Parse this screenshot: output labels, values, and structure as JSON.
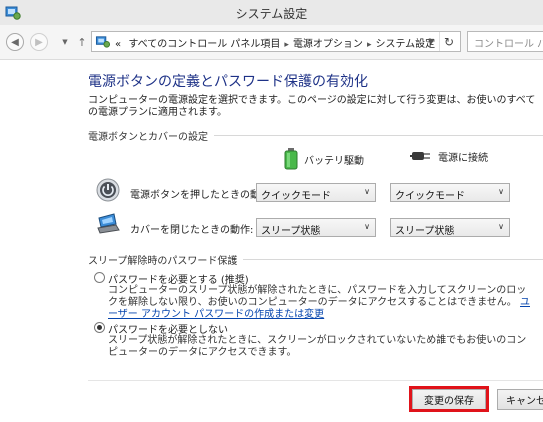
{
  "window": {
    "title": "システム設定"
  },
  "nav": {
    "breadcrumb": [
      "すべてのコントロール パネル項目",
      "電源オプション",
      "システム設定"
    ],
    "breadcrumb_prefix": "«",
    "search_placeholder": "コントロール パネル"
  },
  "content": {
    "title": "電源ボタンの定義とパスワード保護の有効化",
    "description": "コンピューターの電源設定を選択できます。このページの設定に対して行う変更は、お使いのすべての電源プランに適用されます。",
    "power_section": {
      "heading": "電源ボタンとカバーの設定",
      "columns": [
        "バッテリ駆動",
        "電源に接続"
      ],
      "rows": [
        {
          "label": "電源ボタンを押したときの動作:",
          "battery": "クイックモード",
          "plugged": "クイックモード"
        },
        {
          "label": "カバーを閉じたときの動作:",
          "battery": "スリープ状態",
          "plugged": "スリープ状態"
        }
      ]
    },
    "password_section": {
      "heading": "スリープ解除時のパスワード保護",
      "options": [
        {
          "label": "パスワードを必要とする (推奨)",
          "description": "コンピューターのスリープ状態が解除されたときに、パスワードを入力してスクリーンのロックを解除しない限り、お使いのコンピューターのデータにアクセスすることはできません。",
          "link": "ユーザー アカウント パスワードの作成または変更",
          "checked": false
        },
        {
          "label": "パスワードを必要としない",
          "description": "スリープ状態が解除されたときに、スクリーンがロックされていないため誰でもお使いのコンピューターのデータにアクセスできます。",
          "checked": true
        }
      ]
    }
  },
  "footer": {
    "save_label": "変更の保存",
    "cancel_label": "キャンセル"
  },
  "colors": {
    "title": "#1e3287",
    "link": "#0645ad",
    "highlight": "#e0131a"
  }
}
